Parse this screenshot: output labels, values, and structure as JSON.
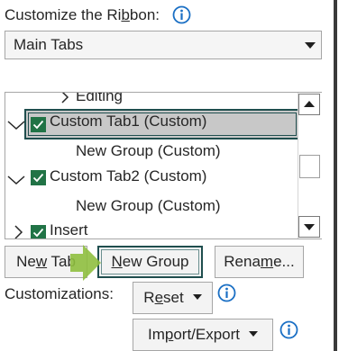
{
  "header": {
    "customize_label_pre": "Customize the Ri",
    "customize_label_u": "b",
    "customize_label_post": "bon:"
  },
  "dropdown": {
    "selected": "Main Tabs"
  },
  "tree": {
    "rows": [
      {
        "label": "Editing",
        "checked": false,
        "expanded": false,
        "level": 2
      },
      {
        "label": "Custom Tab1 (Custom)",
        "checked": true,
        "expanded": true,
        "selected": true
      },
      {
        "label": "New Group (Custom)",
        "level": 2
      },
      {
        "label": "Custom Tab2 (Custom)",
        "checked": true,
        "expanded": true
      },
      {
        "label": "New Group (Custom)",
        "level": 2
      },
      {
        "label": "Insert",
        "checked": true,
        "expanded": false
      }
    ]
  },
  "buttons": {
    "new_tab_pre": "Ne",
    "new_tab_u": "w",
    "new_tab_post": " Tab",
    "new_group_pre": "",
    "new_group_u": "N",
    "new_group_post": "ew Group",
    "rename_pre": "Rena",
    "rename_u": "m",
    "rename_post": "e...",
    "reset_pre": "R",
    "reset_u": "e",
    "reset_post": "set",
    "import_pre": "Im",
    "import_u": "p",
    "import_post": "ort/Export"
  },
  "customizations_label": "Customizations:",
  "colors": {
    "accent_green": "#217346",
    "info_blue": "#1a6fc4",
    "focus_border": "#1f4e4e",
    "hint_arrow": "#8fbf3f"
  },
  "icons": [
    "info-icon",
    "chevron-down-icon",
    "chevron-right-icon",
    "checkbox-checked-icon",
    "scroll-up-icon",
    "scroll-down-icon",
    "caret-down-icon",
    "hint-arrow-icon"
  ]
}
